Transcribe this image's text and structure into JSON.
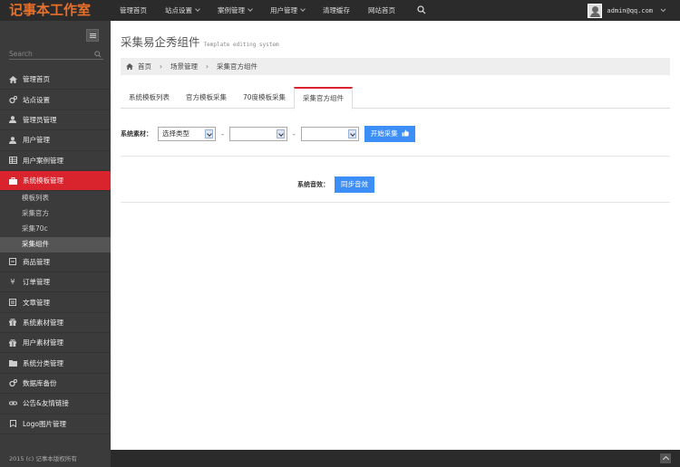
{
  "app": {
    "logo": "记事本工作室"
  },
  "topnav": {
    "items": [
      {
        "label": "管理首页",
        "dropdown": false
      },
      {
        "label": "站点设置",
        "dropdown": true
      },
      {
        "label": "案例管理",
        "dropdown": true
      },
      {
        "label": "用户管理",
        "dropdown": true
      },
      {
        "label": "清理缓存",
        "dropdown": false
      },
      {
        "label": "网站首页",
        "dropdown": false
      }
    ],
    "user_email": "admin@qq.com"
  },
  "sidebar": {
    "search_placeholder": "Search",
    "items": [
      {
        "label": "管理首页",
        "icon": "home-icon"
      },
      {
        "label": "站点设置",
        "icon": "cogs-icon"
      },
      {
        "label": "管理员管理",
        "icon": "user-icon"
      },
      {
        "label": "用户管理",
        "icon": "user-icon"
      },
      {
        "label": "用户案例管理",
        "icon": "table-icon"
      },
      {
        "label": "系统模板管理",
        "icon": "briefcase-icon",
        "active": true
      },
      {
        "label": "商品管理",
        "icon": "box-icon"
      },
      {
        "label": "订单管理",
        "icon": "yen-icon"
      },
      {
        "label": "文章管理",
        "icon": "article-icon"
      },
      {
        "label": "系统素材管理",
        "icon": "gift-icon"
      },
      {
        "label": "用户素材管理",
        "icon": "gift-icon"
      },
      {
        "label": "系统分类管理",
        "icon": "folder-icon"
      },
      {
        "label": "数据库备份",
        "icon": "cogs-icon"
      },
      {
        "label": "公告&友情链接",
        "icon": "link-icon"
      },
      {
        "label": "Logo图片管理",
        "icon": "bookmark-icon"
      }
    ],
    "subitems": [
      "模板列表",
      "采集官方",
      "采集70c",
      "采集组件"
    ],
    "footer": "2015 (c) 记事本版权所有"
  },
  "main": {
    "title": "采集易企秀组件",
    "subtitle": "Template editing system",
    "breadcrumb": [
      "首页",
      "场景管理",
      "采集官方组件"
    ],
    "tabs": [
      "系统模板列表",
      "官方模板采集",
      "70度模板采集",
      "采集官方组件"
    ],
    "active_tab": 3,
    "material_label": "系统素材：",
    "select1_value": "选择类型",
    "select2_value": "",
    "select3_value": "",
    "start_button": "开始采集",
    "sound_label": "系统音效：",
    "sync_button": "同步音效"
  },
  "colors": {
    "accent": "#d9232d",
    "primary_button": "#3e8ef7",
    "logo": "#e8702a"
  }
}
